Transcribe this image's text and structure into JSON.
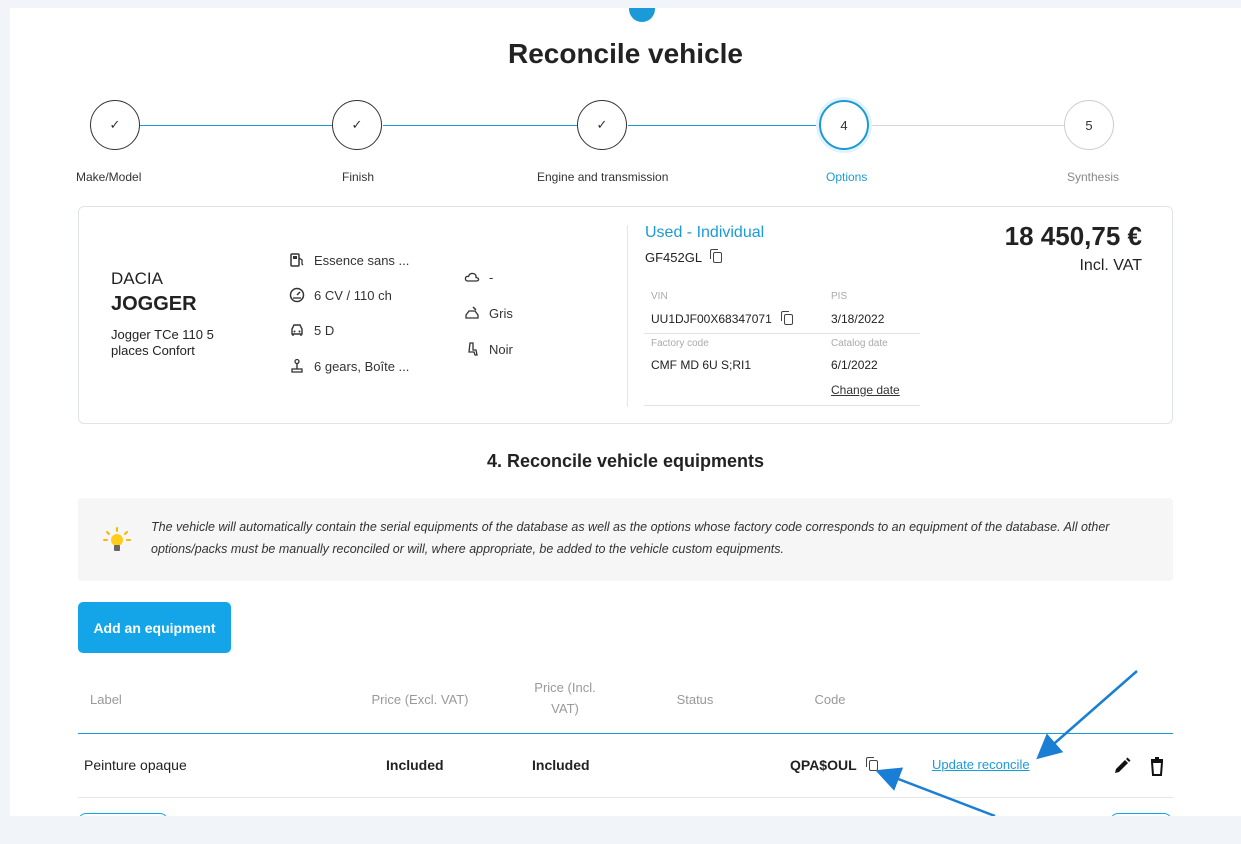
{
  "page": {
    "title": "Reconcile vehicle"
  },
  "stepper": {
    "steps": [
      {
        "number": "✓",
        "label": "Make/Model",
        "state": "done"
      },
      {
        "number": "✓",
        "label": "Finish",
        "state": "done"
      },
      {
        "number": "✓",
        "label": "Engine and transmission",
        "state": "done"
      },
      {
        "number": "4",
        "label": "Options",
        "state": "active"
      },
      {
        "number": "5",
        "label": "Synthesis",
        "state": "pending"
      }
    ]
  },
  "vehicle": {
    "make": "DACIA",
    "model": "JOGGER",
    "variant": "Jogger TCe 110 5 places Confort",
    "specs": {
      "fuel": "Essence sans ...",
      "power": "6 CV / 110 ch",
      "doors": "5 D",
      "gearbox": "6 gears, Boîte ...",
      "weather": "-",
      "exterior_color": "Gris",
      "interior_color": "Noir"
    },
    "type_label": "Used - Individual",
    "plate": "GF452GL",
    "vin_label": "VIN",
    "vin": "UU1DJF00X68347071",
    "pis_label": "PIS",
    "pis": "3/18/2022",
    "factory_code_label": "Factory code",
    "factory_code": "CMF MD 6U S;RI1",
    "catalog_date_label": "Catalog date",
    "catalog_date": "6/1/2022",
    "change_date_label": "Change date",
    "price": "18 450,75 €",
    "price_vat_note": "Incl. VAT"
  },
  "equipments": {
    "section_title": "4. Reconcile vehicle equipments",
    "info_text": "The vehicle will automatically contain the serial equipments of the database as well as the options whose factory code corresponds to an equipment of the database. All other options/packs must be manually reconciled or will, where appropriate, be added to the vehicle custom equipments.",
    "add_button_label": "Add an equipment",
    "columns": {
      "label": "Label",
      "price_excl": "Price (Excl. VAT)",
      "price_incl": "Price (Incl. VAT)",
      "status": "Status",
      "code": "Code"
    },
    "rows": [
      {
        "label": "Peinture opaque",
        "price_excl": "Included",
        "price_incl": "Included",
        "status": "",
        "code": "QPA$OUL",
        "action_link": "Update reconcile"
      }
    ]
  },
  "annotation_color": "#1a7fd4",
  "accent_color": "#14a5e9",
  "icons": [
    "fuel-icon",
    "speedometer-icon",
    "car-door-icon",
    "gearbox-icon",
    "cloud-icon",
    "paint-icon",
    "seat-icon",
    "copy-icon",
    "lightbulb-icon",
    "edit-icon",
    "delete-icon"
  ]
}
